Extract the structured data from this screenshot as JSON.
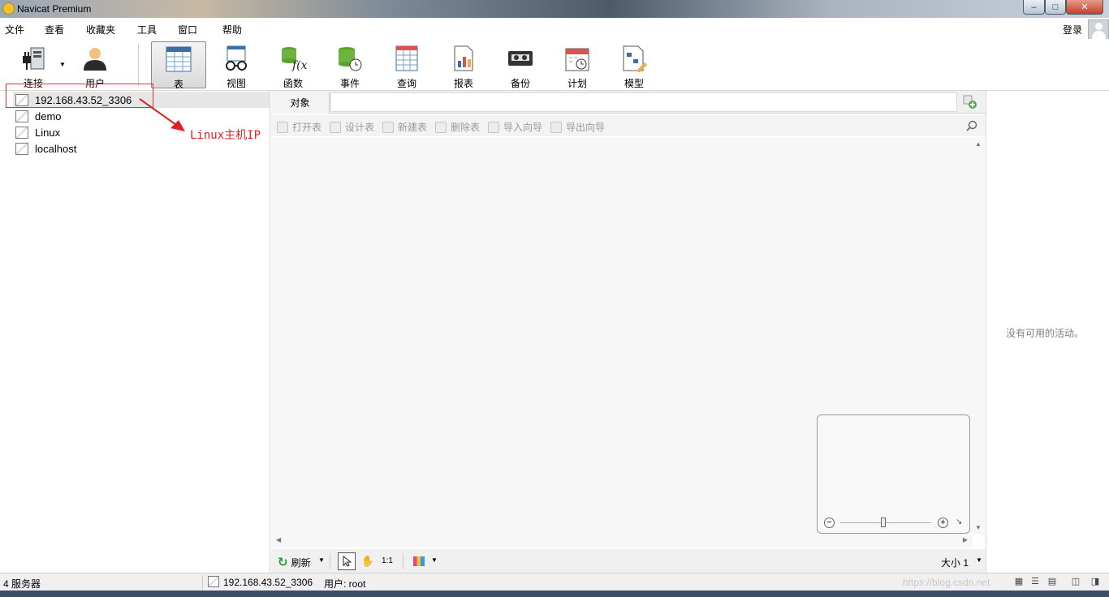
{
  "window": {
    "title": "Navicat Premium",
    "minimize": "–",
    "maximize": "□",
    "close": "✕"
  },
  "menu": {
    "items": [
      "文件",
      "查看",
      "收藏夹",
      "工具",
      "窗口",
      "帮助"
    ],
    "login": "登录"
  },
  "toolbar": {
    "connect": "连接",
    "user": "用户",
    "table": "表",
    "view": "视图",
    "function": "函数",
    "event": "事件",
    "query": "查询",
    "report": "报表",
    "backup": "备份",
    "schedule": "计划",
    "model": "模型"
  },
  "connections": [
    "192.168.43.52_3306",
    "demo",
    "Linux",
    "localhost"
  ],
  "annotation": {
    "text": "Linux主机IP"
  },
  "objects": {
    "tab": "对象"
  },
  "actions": {
    "open": "打开表",
    "design": "设计表",
    "new": "新建表",
    "delete": "删除表",
    "import": "导入向导",
    "export": "导出向导"
  },
  "bottom": {
    "refresh": "刷新",
    "size": "大小 1",
    "fit": "1:1"
  },
  "info": {
    "no_activity": "没有可用的活动。"
  },
  "status": {
    "servers": "4 服务器",
    "connection": "192.168.43.52_3306",
    "user": "用户: root",
    "watermark": "https://blog.csdn.net"
  },
  "colors": {
    "annotation": "#e02020",
    "refresh": "#2a9a2a"
  }
}
